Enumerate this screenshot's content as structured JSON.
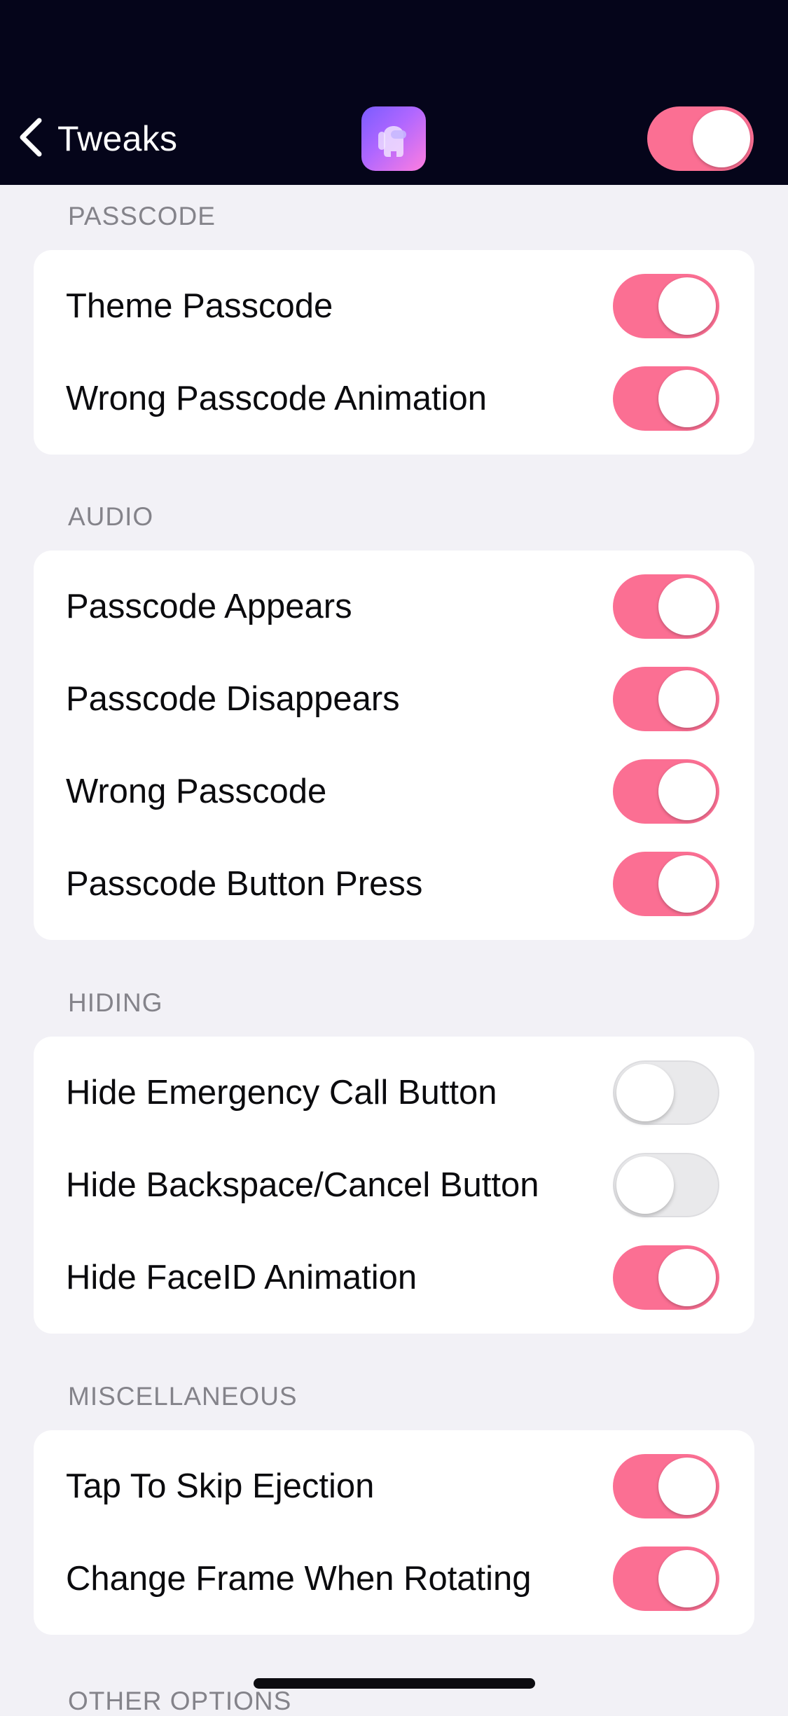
{
  "nav": {
    "back_label": "Tweaks",
    "master_toggle_on": true
  },
  "colors": {
    "accent": "#fb6f93",
    "nav_background": "#05051a",
    "page_background": "#f2f1f6"
  },
  "sections": [
    {
      "header": "PASSCODE",
      "items": [
        {
          "label": "Theme Passcode",
          "on": true
        },
        {
          "label": "Wrong Passcode Animation",
          "on": true
        }
      ]
    },
    {
      "header": "AUDIO",
      "items": [
        {
          "label": "Passcode Appears",
          "on": true
        },
        {
          "label": "Passcode Disappears",
          "on": true
        },
        {
          "label": "Wrong Passcode",
          "on": true
        },
        {
          "label": "Passcode Button Press",
          "on": true
        }
      ]
    },
    {
      "header": "HIDING",
      "items": [
        {
          "label": "Hide Emergency Call Button",
          "on": false
        },
        {
          "label": "Hide Backspace/Cancel Button",
          "on": false
        },
        {
          "label": "Hide FaceID Animation",
          "on": true
        }
      ]
    },
    {
      "header": "MISCELLANEOUS",
      "items": [
        {
          "label": "Tap To Skip Ejection",
          "on": true
        },
        {
          "label": "Change Frame When Rotating",
          "on": true
        }
      ]
    },
    {
      "header": "OTHER OPTIONS",
      "items": []
    }
  ]
}
